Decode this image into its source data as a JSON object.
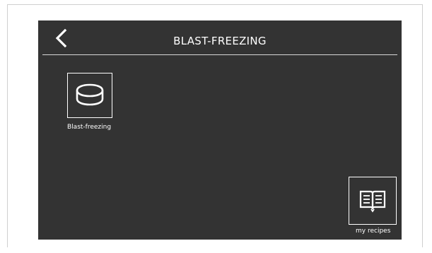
{
  "header": {
    "title": "BLAST-FREEZING",
    "back_icon": "chevron-left-icon"
  },
  "programs": [
    {
      "label": "Blast-freezing",
      "icon": "tray-icon"
    }
  ],
  "recipes_button": {
    "label": "my recipes",
    "icon": "open-book-icon"
  },
  "colors": {
    "screen_background": "#333333",
    "foreground": "#ffffff",
    "page_background": "#ffffff"
  }
}
